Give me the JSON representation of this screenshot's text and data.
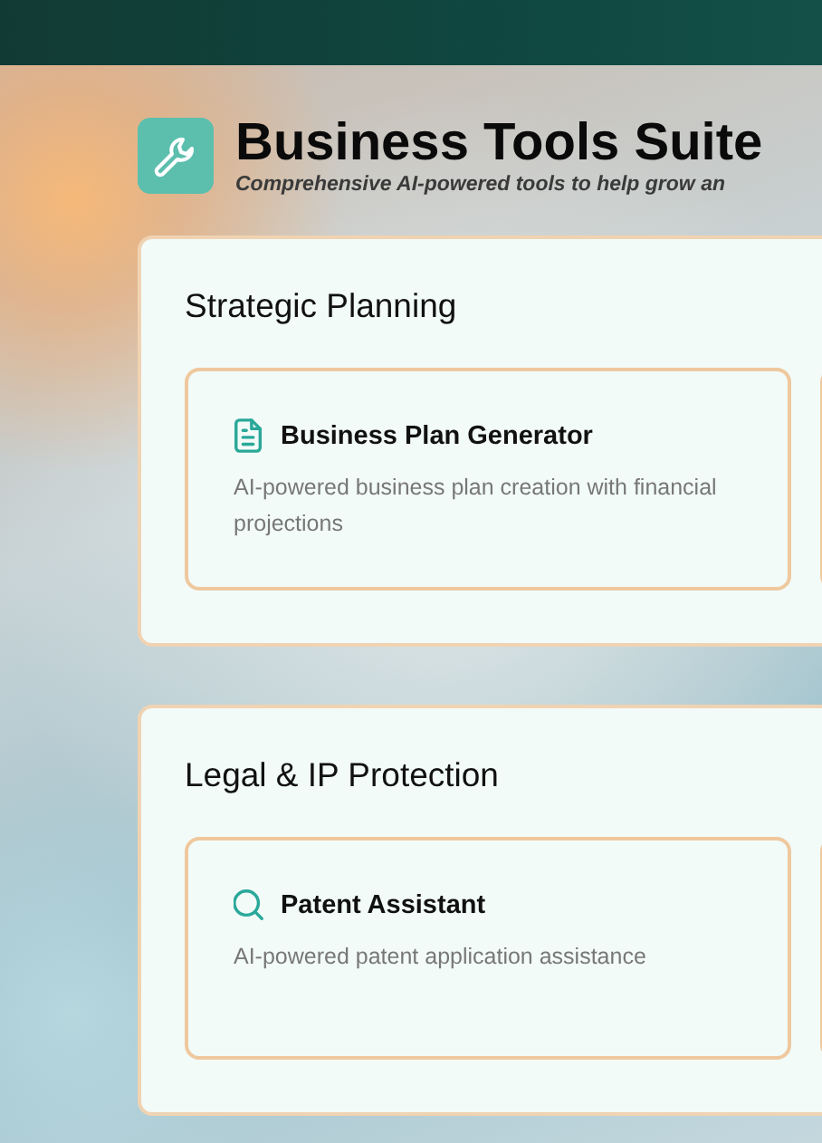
{
  "header": {
    "title": "Business Tools Suite",
    "subtitle": "Comprehensive AI-powered tools to help grow an"
  },
  "sections": [
    {
      "title": "Strategic Planning",
      "tools": [
        {
          "kind": "document",
          "title": "Business Plan Generator",
          "description": "AI-powered business plan creation with financial projections"
        }
      ]
    },
    {
      "title": "Legal & IP Protection",
      "tools": [
        {
          "kind": "search",
          "title": "Patent Assistant",
          "description": "AI-powered patent application assistance"
        }
      ]
    }
  ]
}
